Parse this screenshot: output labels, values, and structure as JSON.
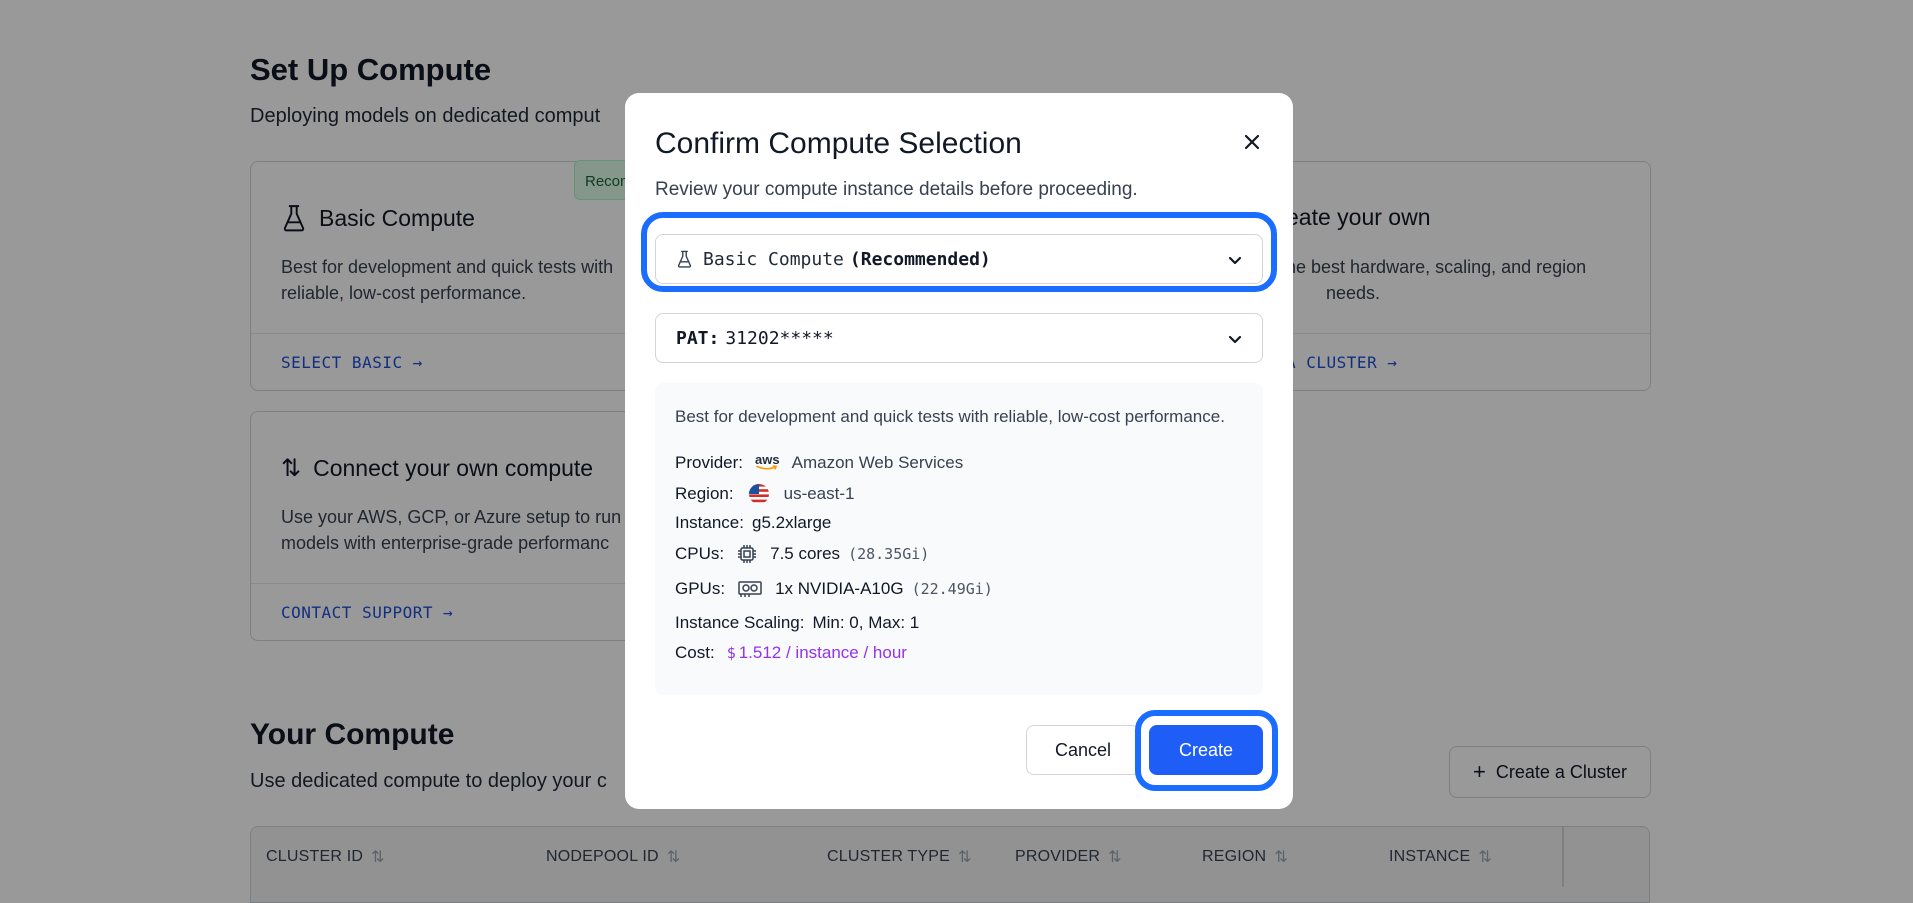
{
  "background": {
    "setup_title": "Set Up Compute",
    "setup_subtitle": "Deploying models on dedicated comput",
    "recommended_badge": "Recom",
    "cards": {
      "basic": {
        "title": "Basic Compute",
        "desc_line1": "Best for development and quick tests with",
        "desc_line2": "reliable, low-cost performance.",
        "link": "SELECT BASIC"
      },
      "create_own": {
        "title": "eate your own",
        "desc_line1": "he best hardware, scaling, and region",
        "desc_line2": "needs.",
        "link": "A CLUSTER"
      },
      "connect": {
        "title": "Connect your own compute",
        "desc_line1": "Use your AWS, GCP, or Azure setup to run",
        "desc_line2": "models with enterprise-grade performanc",
        "link": "CONTACT SUPPORT"
      }
    },
    "your_compute_title": "Your Compute",
    "your_compute_subtitle": "Use dedicated compute to deploy your c",
    "create_cluster_button": "Create a Cluster",
    "table_columns": [
      "CLUSTER ID",
      "NODEPOOL ID",
      "CLUSTER TYPE",
      "PROVIDER",
      "REGION",
      "INSTANCE"
    ]
  },
  "modal": {
    "title": "Confirm Compute Selection",
    "subtitle": "Review your compute instance details before proceeding.",
    "compute_select": {
      "value": "Basic Compute",
      "tag": "(Recommended)"
    },
    "pat_select": {
      "label": "PAT:",
      "value": "31202*****"
    },
    "details": {
      "description": "Best for development and quick tests with reliable, low-cost performance.",
      "provider_label": "Provider:",
      "provider_logo": "aws",
      "provider_value": "Amazon Web Services",
      "region_label": "Region:",
      "region_value": "us-east-1",
      "instance_label": "Instance:",
      "instance_value": "g5.2xlarge",
      "cpus_label": "CPUs:",
      "cpus_value": "7.5 cores",
      "cpus_mem": "(28.35Gi)",
      "gpus_label": "GPUs:",
      "gpus_value": "1x NVIDIA-A10G",
      "gpus_mem": "(22.49Gi)",
      "scaling_label": "Instance Scaling:",
      "scaling_value": "Min: 0, Max: 1",
      "cost_label": "Cost:",
      "cost_symbol": "$",
      "cost_value": "1.512 / instance / hour"
    },
    "cancel_label": "Cancel",
    "create_label": "Create"
  },
  "colors": {
    "accent": "#1e5ef6",
    "focus_ring": "#1a6dff",
    "link": "#1d4ed8",
    "cost": "#9333ea"
  }
}
